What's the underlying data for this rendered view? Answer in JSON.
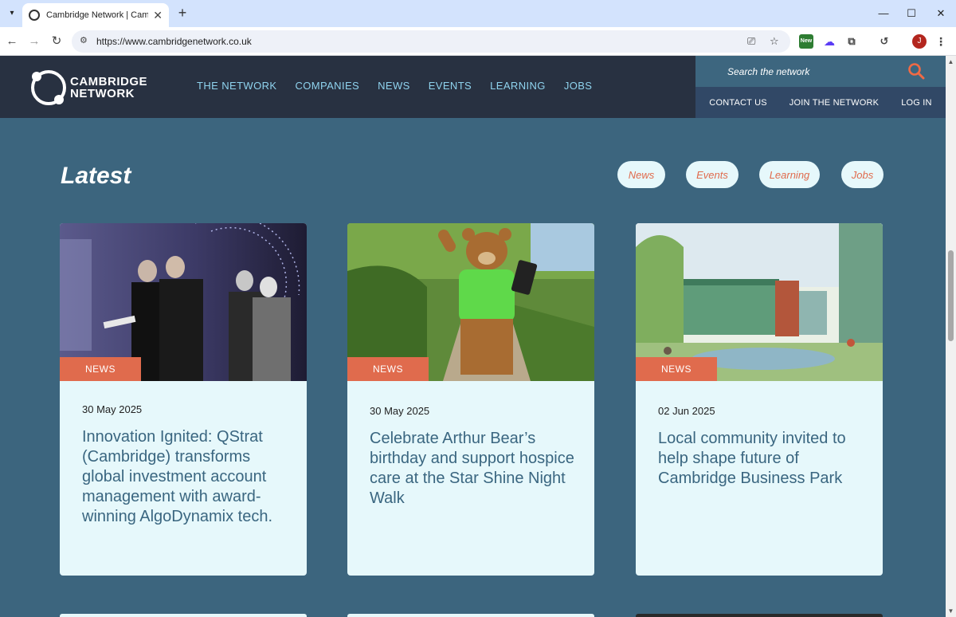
{
  "browser": {
    "tab_title": "Cambridge Network | Cambridge Network",
    "url": "https://www.cambridgenetwork.co.uk",
    "extension_badge": "New",
    "profile_initial": "J"
  },
  "site": {
    "logo_line1": "CAMBRIDGE",
    "logo_line2": "NETWORK",
    "nav": [
      "THE NETWORK",
      "COMPANIES",
      "NEWS",
      "EVENTS",
      "LEARNING",
      "JOBS"
    ],
    "search_placeholder": "Search the network",
    "util_nav": [
      "CONTACT US",
      "JOIN THE NETWORK",
      "LOG IN"
    ]
  },
  "latest": {
    "heading": "Latest",
    "filters": [
      "News",
      "Events",
      "Learning",
      "Jobs"
    ],
    "cards": [
      {
        "badge": "NEWS",
        "date": "30 May 2025",
        "title": "Innovation Ignited: QStrat (Cambridge) transforms global investment account management with award-winning AlgoDynamix tech."
      },
      {
        "badge": "NEWS",
        "date": "30 May 2025",
        "title": "Celebrate Arthur Bear’s birthday and support hospice care at the Star Shine Night Walk"
      },
      {
        "badge": "NEWS",
        "date": "02 Jun 2025",
        "title": "Local community invited to help shape future of Cambridge Business Park"
      }
    ]
  },
  "colors": {
    "page_bg": "#3c657e",
    "header_bg": "#283141",
    "nav_link": "#8fd3ee",
    "accent": "#e06b4d",
    "card_bg": "#e6f8fb",
    "card_title": "#3a6680"
  }
}
